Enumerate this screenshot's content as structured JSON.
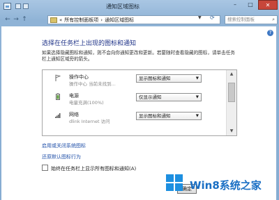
{
  "window": {
    "title": "通知区域图标",
    "controls": {
      "minimize": "–",
      "maximize": "□",
      "close": "✕"
    }
  },
  "nav": {
    "back": "←",
    "forward": "→",
    "up": "↑",
    "breadcrumb": [
      "«",
      "所有控制面板项",
      "›",
      "通知区域图标"
    ],
    "search_placeholder": "搜索控制面板"
  },
  "main": {
    "help": "?",
    "heading": "选择在任务栏上出现的图标和通知",
    "description": "如果选择隐藏图标和通知，则不会向你通知更改和更新。若要随时查看隐藏的图标，请单击任务栏上通知区域旁的箭头。",
    "list": [
      {
        "name": "操作中心",
        "sub": "操作中心    当前未找到...",
        "value": "显示图标和通知",
        "icon": "flag-icon"
      },
      {
        "name": "电源",
        "sub": "电量充满(100%)",
        "value": "仅显示通知",
        "icon": "battery-icon"
      },
      {
        "name": "网络",
        "sub": "dlink Internet 访问",
        "value": "显示图标和通知",
        "icon": "network-icon"
      }
    ],
    "links": {
      "system_icons": "启用或关闭系统图标",
      "restore": "还原默认图标行为"
    },
    "always_show": "始终在任务栏上显示所有图标和通知(A)",
    "ok": "确定"
  },
  "watermark": {
    "text": "Win8系统之家"
  }
}
